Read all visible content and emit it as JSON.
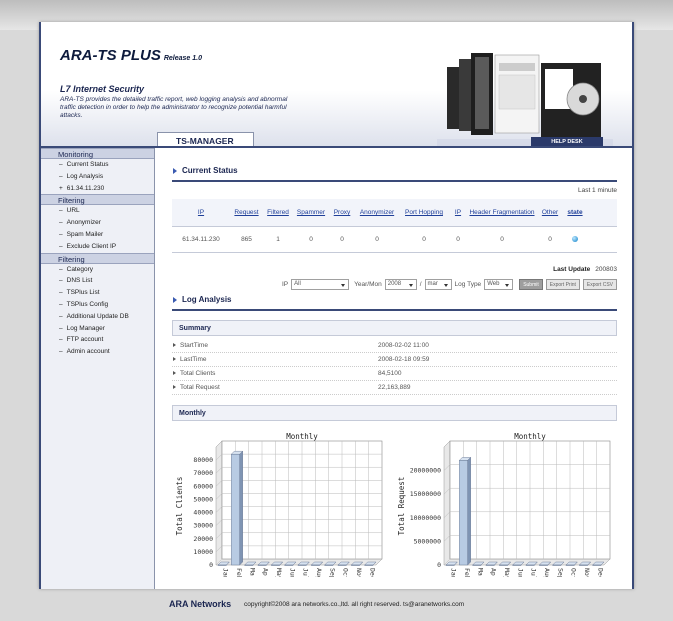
{
  "header": {
    "brand": "ARA-TS PLUS",
    "release": "Release 1.0",
    "tagline": "L7 Internet Security",
    "description": "ARA-TS provides the detailed traffic report, web logging analysis and abnormal traffic detection in order to help the administrator to recognize potential harmful attacks."
  },
  "tab": {
    "label": "TS-MANAGER"
  },
  "helpdesk": {
    "label": "HELP DESK"
  },
  "sidebar": {
    "sections": [
      {
        "title": "Monitoring",
        "items": [
          {
            "prefix": "–",
            "label": "Current Status"
          },
          {
            "prefix": "–",
            "label": "Log Analysis"
          },
          {
            "prefix": "+",
            "label": "61.34.11.230"
          }
        ]
      },
      {
        "title": "Filtering",
        "items": [
          {
            "prefix": "–",
            "label": "URL"
          },
          {
            "prefix": "–",
            "label": "Anonymizer"
          },
          {
            "prefix": "–",
            "label": "Spam Mailer"
          },
          {
            "prefix": "–",
            "label": "Exclude Client IP"
          }
        ]
      },
      {
        "title": "Filtering",
        "items": [
          {
            "prefix": "–",
            "label": "Category"
          },
          {
            "prefix": "–",
            "label": "DNS List"
          },
          {
            "prefix": "–",
            "label": "TSPlus List"
          },
          {
            "prefix": "–",
            "label": "TSPlus Config"
          },
          {
            "prefix": "–",
            "label": "Additional Update DB"
          },
          {
            "prefix": "–",
            "label": "Log Manager"
          },
          {
            "prefix": "–",
            "label": "FTP account"
          },
          {
            "prefix": "–",
            "label": "Admin account"
          }
        ]
      }
    ]
  },
  "current_status": {
    "title": "Current Status",
    "period": "Last 1 minute",
    "columns": [
      "IP",
      "Request",
      "Filtered",
      "Spammer",
      "Proxy",
      "Anonymizer",
      "Port Hopping",
      "IP",
      "Header Fragmentation",
      "Other",
      "state"
    ],
    "row": [
      "61.34.11.230",
      "865",
      "1",
      "0",
      "0",
      "0",
      "0",
      "0",
      "0",
      "0"
    ]
  },
  "last_update": {
    "label": "Last Update",
    "value": "200803"
  },
  "filters": {
    "ip_label": "IP",
    "ip_value": "All",
    "yearmon_label": "Year/Mon",
    "year_value": "2008",
    "slash": "/",
    "month_value": "mar",
    "logtype_label": "Log Type",
    "logtype_value": "Web",
    "submit": "Submit",
    "export_print": "Export Print",
    "export_csv": "Export CSV"
  },
  "log_analysis": {
    "title": "Log Analysis"
  },
  "summary": {
    "title": "Summary",
    "rows": [
      {
        "label": "StartTime",
        "value": "2008-02-02 11:00"
      },
      {
        "label": "LastTime",
        "value": "2008-02-18 09:59"
      },
      {
        "label": "Total Clients",
        "value": "84,5100"
      },
      {
        "label": "Total Request",
        "value": "22,163,889"
      }
    ]
  },
  "monthly": {
    "title": "Monthly"
  },
  "chart_data": [
    {
      "type": "bar",
      "title": "Monthly",
      "ylabel": "Total Clients",
      "xlabel": "",
      "categories": [
        "Jan",
        "Feb",
        "Mar",
        "Apr",
        "May",
        "Jun",
        "Jul",
        "Aug",
        "Sep",
        "Oct",
        "Nov",
        "Dec"
      ],
      "values": [
        0,
        84510,
        0,
        0,
        0,
        0,
        0,
        0,
        0,
        0,
        0,
        0
      ],
      "yticks": [
        0,
        10000,
        20000,
        30000,
        40000,
        50000,
        60000,
        70000,
        80000
      ],
      "ylim": [
        0,
        90000
      ],
      "grid": true,
      "style": "3d",
      "bar_color": "#b8cbe3"
    },
    {
      "type": "bar",
      "title": "Monthly",
      "ylabel": "Total Request",
      "xlabel": "",
      "categories": [
        "Jan",
        "Feb",
        "Mar",
        "Apr",
        "May",
        "Jun",
        "Jul",
        "Aug",
        "Sep",
        "Oct",
        "Nov",
        "Dec"
      ],
      "values": [
        0,
        22163889,
        0,
        0,
        0,
        0,
        0,
        0,
        0,
        0,
        0,
        0
      ],
      "yticks": [
        0,
        5000000,
        10000000,
        15000000,
        20000000
      ],
      "ylim": [
        0,
        25000000
      ],
      "grid": true,
      "style": "3d",
      "bar_color": "#b8cbe3"
    }
  ],
  "footer": {
    "brand": "ARA Networks",
    "copyright": "copyright©2008 ara networks.co.,ltd. all right reserved. ts@aranetworks.com"
  }
}
